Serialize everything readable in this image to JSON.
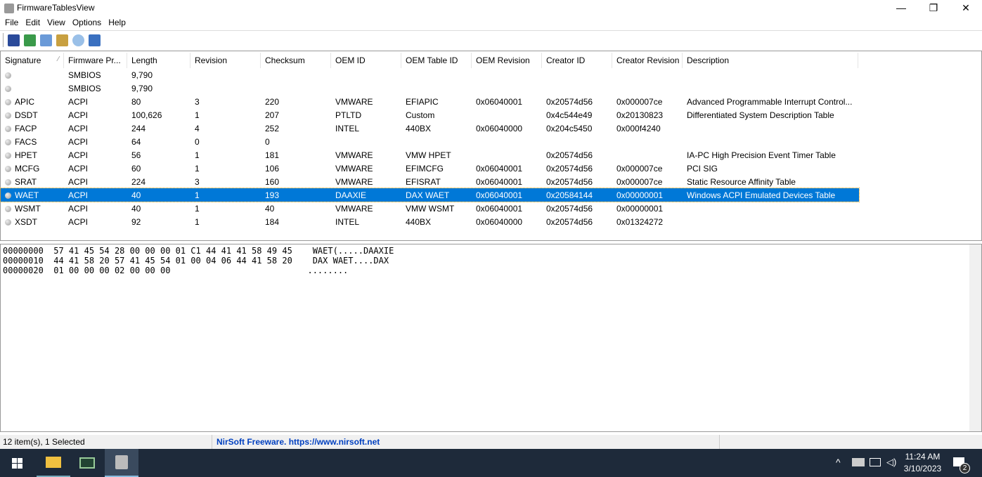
{
  "window": {
    "title": "FirmwareTablesView",
    "minimize": "—",
    "maximize": "❐",
    "close": "✕"
  },
  "menu": [
    "File",
    "Edit",
    "View",
    "Options",
    "Help"
  ],
  "columns": [
    "Signature",
    "Firmware Pr...",
    "Length",
    "Revision",
    "Checksum",
    "OEM ID",
    "OEM Table ID",
    "OEM Revision",
    "Creator ID",
    "Creator Revision",
    "Description"
  ],
  "sort_indicator": "⁄",
  "rows": [
    [
      "",
      "SMBIOS",
      "9,790",
      "",
      "",
      "",
      "",
      "",
      "",
      "",
      ""
    ],
    [
      "",
      "SMBIOS",
      "9,790",
      "",
      "",
      "",
      "",
      "",
      "",
      "",
      ""
    ],
    [
      "APIC",
      "ACPI",
      "80",
      "3",
      "220",
      "VMWARE",
      "EFIAPIC",
      "0x06040001",
      "0x20574d56",
      "0x000007ce",
      "Advanced Programmable Interrupt Control..."
    ],
    [
      "DSDT",
      "ACPI",
      "100,626",
      "1",
      "207",
      "PTLTD",
      "Custom",
      "",
      "0x4c544e49",
      "0x20130823",
      "Differentiated System Description Table"
    ],
    [
      "FACP",
      "ACPI",
      "244",
      "4",
      "252",
      "INTEL",
      "440BX",
      "0x06040000",
      "0x204c5450",
      "0x000f4240",
      ""
    ],
    [
      "FACS",
      "ACPI",
      "64",
      "0",
      "0",
      "",
      "",
      "",
      "",
      "",
      ""
    ],
    [
      "HPET",
      "ACPI",
      "56",
      "1",
      "181",
      "VMWARE",
      "VMW HPET",
      "",
      "0x20574d56",
      "",
      "IA-PC High Precision Event Timer Table"
    ],
    [
      "MCFG",
      "ACPI",
      "60",
      "1",
      "106",
      "VMWARE",
      "EFIMCFG",
      "0x06040001",
      "0x20574d56",
      "0x000007ce",
      "PCI SIG"
    ],
    [
      "SRAT",
      "ACPI",
      "224",
      "3",
      "160",
      "VMWARE",
      "EFISRAT",
      "0x06040001",
      "0x20574d56",
      "0x000007ce",
      "Static Resource Affinity Table"
    ],
    [
      "WAET",
      "ACPI",
      "40",
      "1",
      "193",
      "DAAXIE",
      "DAX WAET",
      "0x06040001",
      "0x20584144",
      "0x00000001",
      "Windows ACPI Emulated Devices Table"
    ],
    [
      "WSMT",
      "ACPI",
      "40",
      "1",
      "40",
      "VMWARE",
      "VMW WSMT",
      "0x06040001",
      "0x20574d56",
      "0x00000001",
      ""
    ],
    [
      "XSDT",
      "ACPI",
      "92",
      "1",
      "184",
      "INTEL",
      "440BX",
      "0x06040000",
      "0x20574d56",
      "0x01324272",
      ""
    ]
  ],
  "selected_row": 9,
  "hex_dump": "00000000  57 41 45 54 28 00 00 00 01 C1 44 41 41 58 49 45    WAET(.....DAAXIE\n00000010  44 41 58 20 57 41 45 54 01 00 04 06 44 41 58 20    DAX WAET....DAX \n00000020  01 00 00 00 02 00 00 00                           ........",
  "status": {
    "count": "12 item(s), 1 Selected",
    "link": "NirSoft Freeware. https://www.nirsoft.net"
  },
  "taskbar": {
    "time": "11:24 AM",
    "date": "3/10/2023",
    "notifications": "2",
    "chevron": "^"
  }
}
